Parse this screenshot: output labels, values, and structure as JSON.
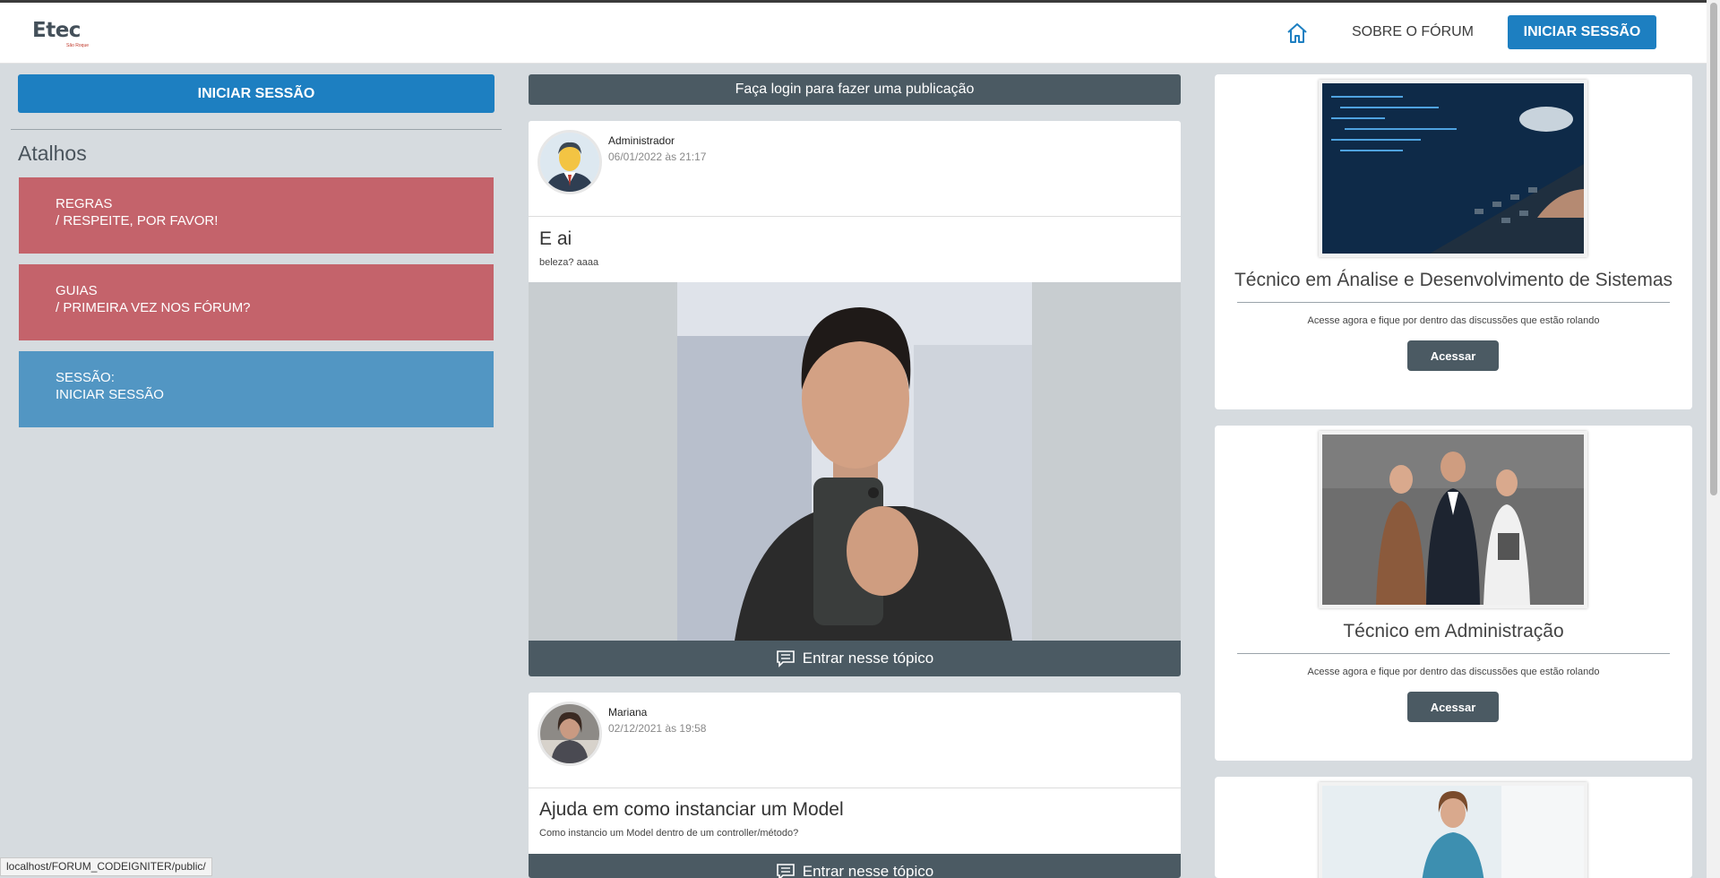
{
  "header": {
    "logo_text": "Etec",
    "logo_sub": "São Roque",
    "about_label": "SOBRE O FÓRUM",
    "login_label": "INICIAR SESSÃO",
    "home_icon": "home-icon"
  },
  "sidebar": {
    "login_label": "INICIAR SESSÃO",
    "shortcuts_title": "Atalhos",
    "items": [
      {
        "line1": "REGRAS",
        "line2": "/ RESPEITE, POR FAVOR!",
        "color": "#c4636b"
      },
      {
        "line1": "GUIAS",
        "line2": "/ PRIMEIRA VEZ NOS FÓRUM?",
        "color": "#c4636b"
      },
      {
        "line1": "SESSÃO:",
        "line2": "INICIAR SESSÃO",
        "color": "#5296c3"
      }
    ]
  },
  "feed": {
    "login_banner": "Faça login para fazer uma publicação",
    "enter_label": "Entrar nesse tópico",
    "posts": [
      {
        "author": "Administrador",
        "date": "06/01/2022 às 21:17",
        "title": "E ai",
        "body": "beleza? aaaa"
      },
      {
        "author": "Mariana",
        "date": "02/12/2021 às 19:58",
        "title": "Ajuda em como instanciar um Model",
        "body": "Como instancio um Model dentro de um controller/método?"
      }
    ]
  },
  "courses": {
    "items": [
      {
        "title": "Técnico em Ánalise e Desenvolvimento de Sistemas",
        "desc": "Acesse agora e fique por dentro das discussões que estão rolando",
        "button": "Acessar"
      },
      {
        "title": "Técnico em Administração",
        "desc": "Acesse agora e fique por dentro das discussões que estão rolando",
        "button": "Acessar"
      }
    ]
  },
  "status_url": "localhost/FORUM_CODEIGNITER/public/",
  "colors": {
    "primary": "#1d7fc1",
    "dark": "#4b5a63",
    "red": "#c4636b",
    "blue": "#5296c3"
  }
}
